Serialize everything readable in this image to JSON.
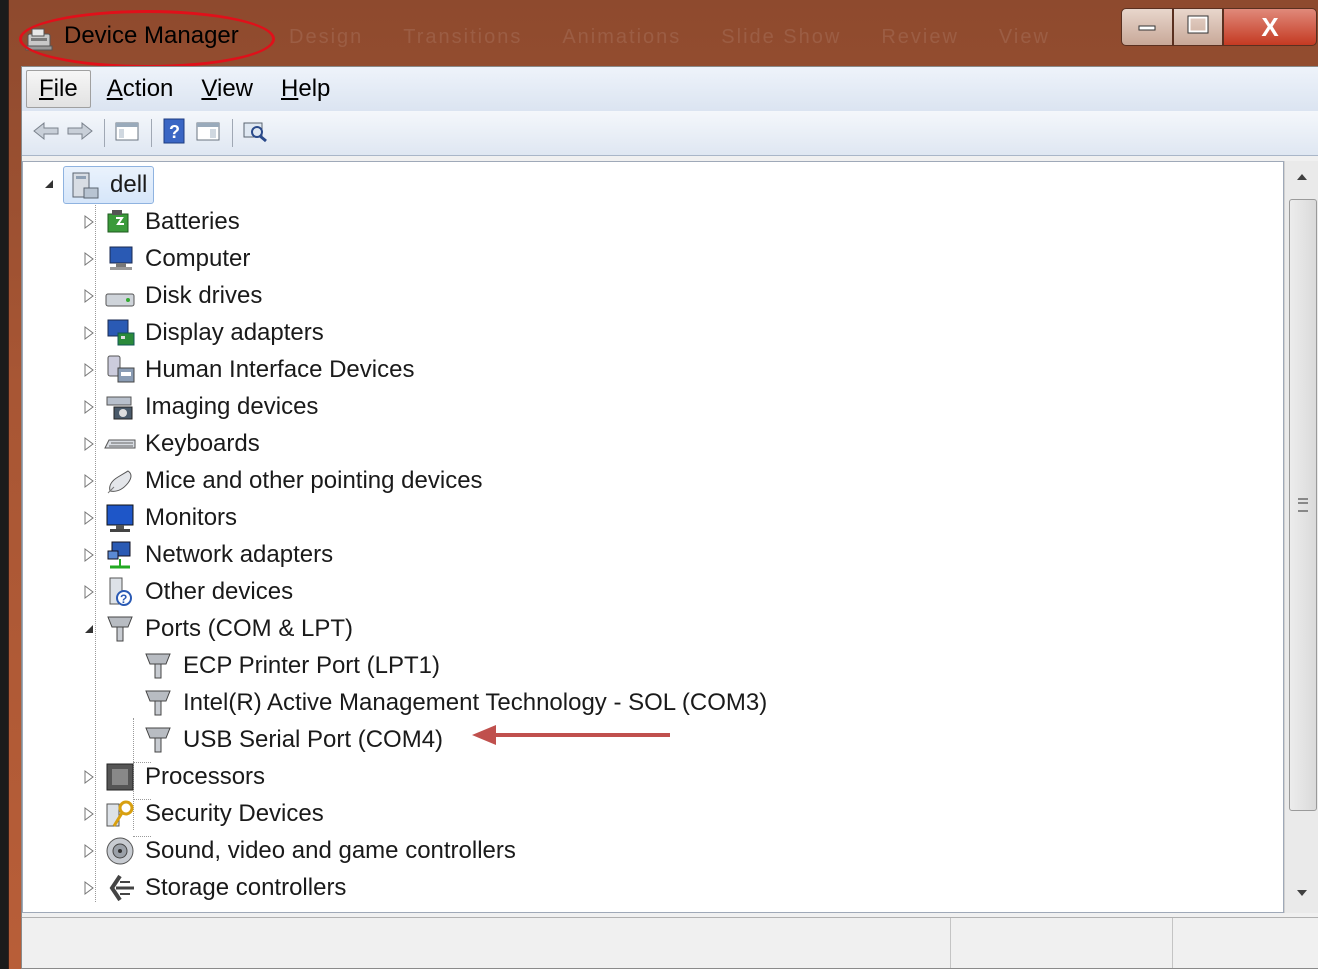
{
  "window": {
    "title": "Device Manager",
    "ghost_tabs": [
      "Design",
      "Transitions",
      "Animations",
      "Slide Show",
      "Review",
      "View"
    ],
    "buttons": {
      "minimize": "minimize",
      "maximize": "maximize",
      "close": "X"
    }
  },
  "menu": {
    "items": [
      {
        "label": "File",
        "mnemonic": "F"
      },
      {
        "label": "Action",
        "mnemonic": "A"
      },
      {
        "label": "View",
        "mnemonic": "V"
      },
      {
        "label": "Help",
        "mnemonic": "H"
      }
    ]
  },
  "toolbar": {
    "icons": [
      "back-icon",
      "forward-icon",
      "show-hide-console-tree-icon",
      "help-icon",
      "properties-icon",
      "scan-hardware-icon"
    ]
  },
  "tree": {
    "root": "dell",
    "categories": [
      {
        "label": "Batteries",
        "icon": "battery-icon",
        "expanded": false
      },
      {
        "label": "Computer",
        "icon": "computer-icon",
        "expanded": false
      },
      {
        "label": "Disk drives",
        "icon": "disk-drive-icon",
        "expanded": false
      },
      {
        "label": "Display adapters",
        "icon": "display-adapter-icon",
        "expanded": false
      },
      {
        "label": "Human Interface Devices",
        "icon": "hid-icon",
        "expanded": false
      },
      {
        "label": "Imaging devices",
        "icon": "camera-icon",
        "expanded": false
      },
      {
        "label": "Keyboards",
        "icon": "keyboard-icon",
        "expanded": false
      },
      {
        "label": "Mice and other pointing devices",
        "icon": "mouse-icon",
        "expanded": false
      },
      {
        "label": "Monitors",
        "icon": "monitor-icon",
        "expanded": false
      },
      {
        "label": "Network adapters",
        "icon": "network-icon",
        "expanded": false
      },
      {
        "label": "Other devices",
        "icon": "unknown-device-icon",
        "expanded": false
      },
      {
        "label": "Ports (COM & LPT)",
        "icon": "port-icon",
        "expanded": true,
        "children": [
          {
            "label": "ECP Printer Port (LPT1)",
            "icon": "port-icon"
          },
          {
            "label": "Intel(R) Active Management Technology - SOL (COM3)",
            "icon": "port-icon"
          },
          {
            "label": "USB Serial Port (COM4)",
            "icon": "port-icon"
          }
        ]
      },
      {
        "label": "Processors",
        "icon": "processor-icon",
        "expanded": false
      },
      {
        "label": "Security Devices",
        "icon": "security-key-icon",
        "expanded": false
      },
      {
        "label": "Sound, video and game controllers",
        "icon": "speaker-icon",
        "expanded": false
      },
      {
        "label": "Storage controllers",
        "icon": "storage-controller-icon",
        "expanded": false
      }
    ]
  },
  "annotations": {
    "title_highlight_color": "#e0101a",
    "arrow_color": "#c0504d"
  },
  "colors": {
    "window_frame": "#a85634",
    "selection": "#d6e6fa",
    "close_button": "#c43a22"
  }
}
